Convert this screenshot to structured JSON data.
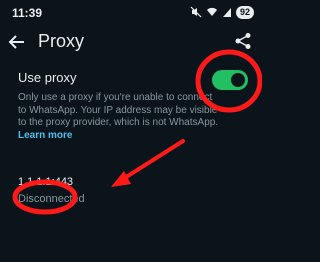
{
  "status_bar": {
    "time": "11:39",
    "battery": "92"
  },
  "app_bar": {
    "title": "Proxy",
    "back_icon": "arrow-left-icon",
    "share_icon": "share-icon"
  },
  "settings": {
    "use_proxy_label": "Use proxy",
    "use_proxy_enabled": true,
    "description_lines": [
      "Only use a proxy if you're unable to connect",
      "to WhatsApp. Your IP address may be visible",
      "to the proxy provider, which is not WhatsApp."
    ],
    "learn_more": "Learn more"
  },
  "proxy": {
    "address": "1.1.1.1:443",
    "status": "Disconnected"
  },
  "colors": {
    "background": "#0b141a",
    "accent": "#21c063",
    "annotation": "#ff1a1a"
  }
}
